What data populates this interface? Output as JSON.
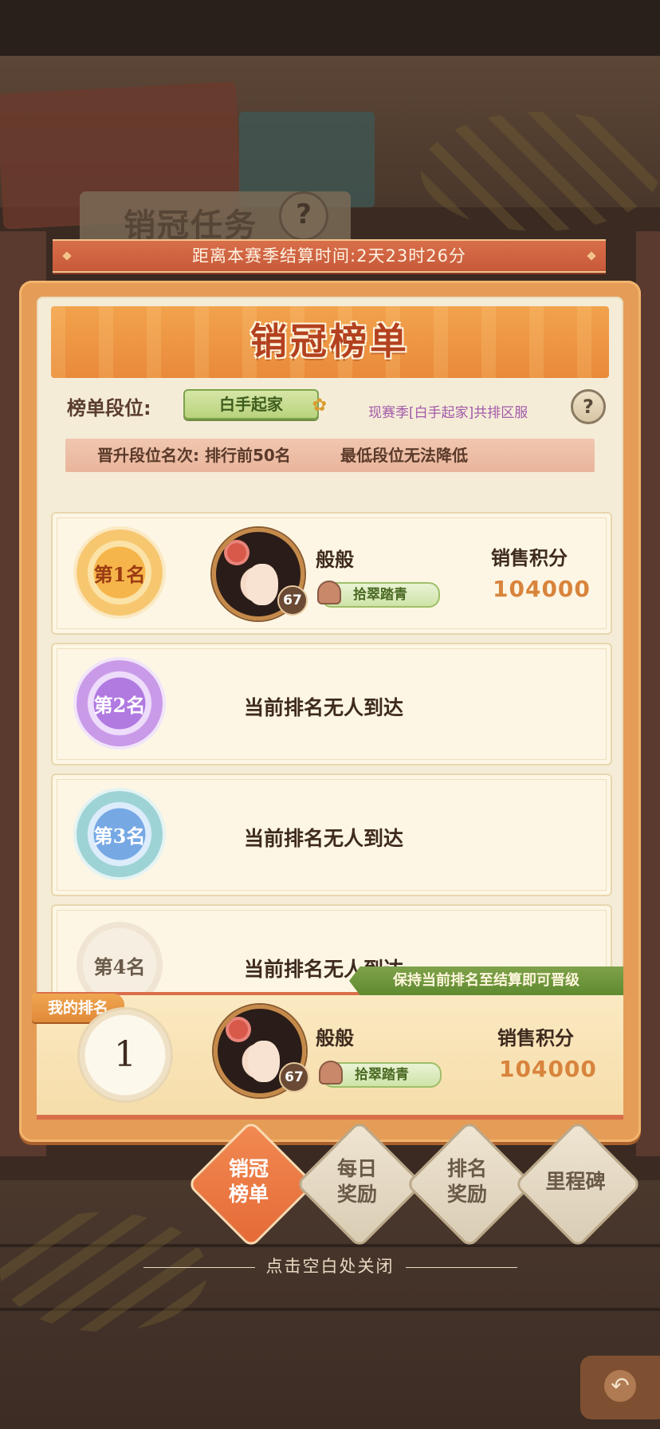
{
  "background": {
    "sign_title": "销冠任务",
    "help": "?"
  },
  "season": {
    "countdown": "距离本赛季结算时间:2天23时26分"
  },
  "panel": {
    "title": "销冠榜单",
    "tier_label": "榜单段位:",
    "tier_badge": "白手起家",
    "tier_note": "现赛季[白手起家]共排区服",
    "help": "?",
    "promo_rule": "晋升段位名次: 排行前50名",
    "demote_rule": "最低段位无法降低"
  },
  "ranks": [
    {
      "rank_label": "第1名",
      "player_name": "般般",
      "level": "67",
      "title_tag": "拾翠踏青",
      "score_label": "销售积分",
      "score": "104000",
      "medal_color": "#f6b54a"
    },
    {
      "rank_label": "第2名",
      "empty_text": "当前排名无人到达",
      "medal_color": "#b07ae0"
    },
    {
      "rank_label": "第3名",
      "empty_text": "当前排名无人到达",
      "medal_color": "#76a8e4"
    },
    {
      "rank_label": "第4名",
      "empty_text": "当前排名无人到达"
    }
  ],
  "my_rank": {
    "tag": "我的排名",
    "promo_ribbon": "保持当前排名至结算即可晋级",
    "rank": "1",
    "player_name": "般般",
    "level": "67",
    "title_tag": "拾翠踏青",
    "score_label": "销售积分",
    "score": "104000"
  },
  "tabs": [
    {
      "label_line1": "销冠",
      "label_line2": "榜单",
      "active": true
    },
    {
      "label_line1": "每日",
      "label_line2": "奖励",
      "active": false
    },
    {
      "label_line1": "排名",
      "label_line2": "奖励",
      "active": false
    },
    {
      "label_line1": "里程碑",
      "label_line2": "",
      "active": false
    }
  ],
  "close_hint": "点击空白处关闭",
  "colors": {
    "accent": "#e56a38",
    "panel_orange": "#e59c56",
    "score": "#d8843c"
  }
}
